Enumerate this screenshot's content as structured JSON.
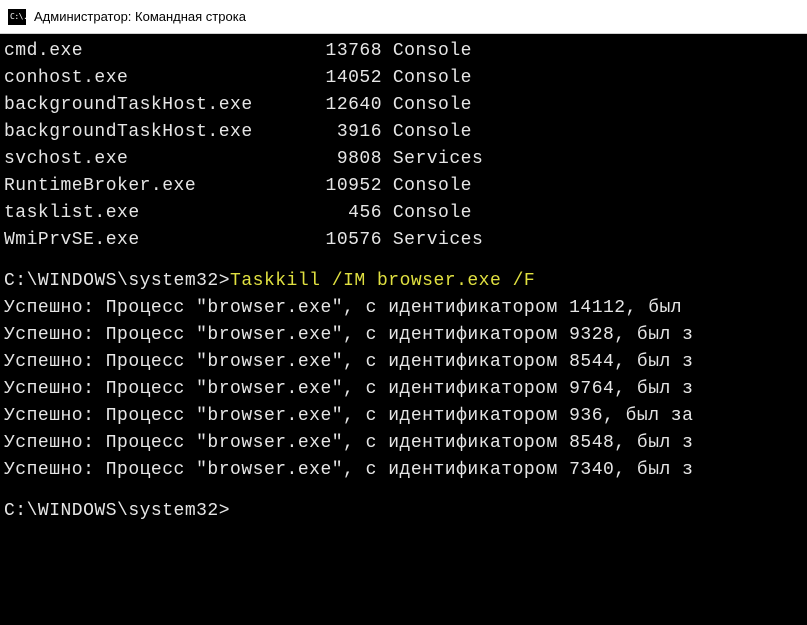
{
  "window": {
    "icon_text": "C:\\.",
    "title": "Администратор: Командная строка"
  },
  "processes": [
    {
      "name": "cmd.exe",
      "pid": "13768",
      "session": "Console"
    },
    {
      "name": "conhost.exe",
      "pid": "14052",
      "session": "Console"
    },
    {
      "name": "backgroundTaskHost.exe",
      "pid": "12640",
      "session": "Console"
    },
    {
      "name": "backgroundTaskHost.exe",
      "pid": "3916",
      "session": "Console"
    },
    {
      "name": "svchost.exe",
      "pid": "9808",
      "session": "Services"
    },
    {
      "name": "RuntimeBroker.exe",
      "pid": "10952",
      "session": "Console"
    },
    {
      "name": "tasklist.exe",
      "pid": "456",
      "session": "Console"
    },
    {
      "name": "WmiPrvSE.exe",
      "pid": "10576",
      "session": "Services"
    }
  ],
  "prompt": {
    "path": "C:\\WINDOWS\\system32",
    "gt": ">",
    "command": "Taskkill /IM browser.exe /F"
  },
  "results_prefix": "Успешно: Процесс \"browser.exe\", с идентификатором ",
  "results_suffix_full": ", был ",
  "results_suffix_trunc": ", был з",
  "results_suffix_trunc2": ", был за",
  "results": [
    {
      "pid": "14112",
      "tail": ", был "
    },
    {
      "pid": "9328",
      "tail": ", был з"
    },
    {
      "pid": "8544",
      "tail": ", был з"
    },
    {
      "pid": "9764",
      "tail": ", был з"
    },
    {
      "pid": "936",
      "tail": ", был за"
    },
    {
      "pid": "8548",
      "tail": ", был з"
    },
    {
      "pid": "7340",
      "tail": ", был з"
    }
  ],
  "final_prompt": {
    "path": "C:\\WINDOWS\\system32",
    "gt": ">"
  }
}
